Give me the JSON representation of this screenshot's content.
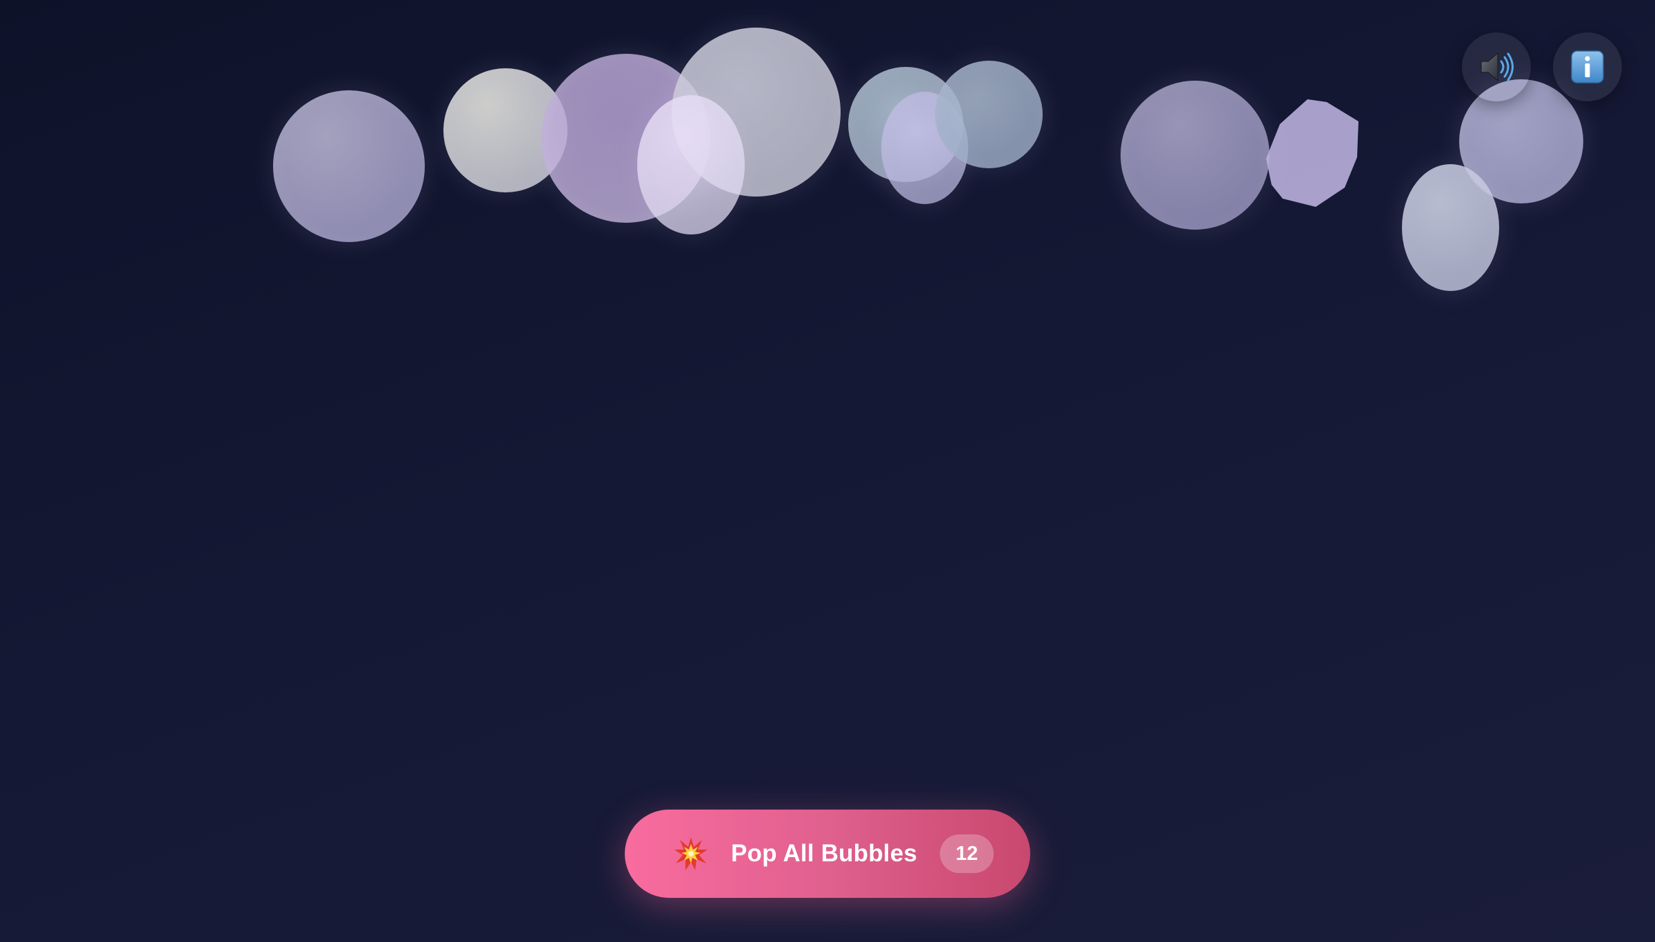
{
  "game": {
    "bubble_count_remaining": 12
  },
  "controls": {
    "sound_icon": "speaker-volume-icon",
    "info_icon": "info-icon"
  },
  "pop_all_button": {
    "icon": "collision-burst-icon",
    "label": "Pop All Bubbles",
    "count": "12"
  },
  "colors": {
    "background_top": "#0e1229",
    "background_bottom": "#1a1d3a",
    "button_gradient_start": "#f86c9e",
    "button_gradient_end": "#c8486f",
    "count_badge_bg": "rgba(255,255,255,0.25)",
    "bubble_lavender": "#a9a4d0",
    "bubble_pale": "#d9d9e6",
    "bubble_teal": "#a6b8cc",
    "bubble_purple": "#bba8de"
  },
  "bubbles": [
    {
      "id": 1,
      "color": "lavender",
      "state": "floating"
    },
    {
      "id": 2,
      "color": "pale",
      "state": "floating"
    },
    {
      "id": 3,
      "color": "purple",
      "state": "floating"
    },
    {
      "id": 4,
      "color": "pale",
      "state": "floating"
    },
    {
      "id": 5,
      "color": "pale",
      "state": "floating"
    },
    {
      "id": 6,
      "color": "teal",
      "state": "floating"
    },
    {
      "id": 7,
      "color": "lavender",
      "state": "floating"
    },
    {
      "id": 8,
      "color": "teal",
      "state": "floating"
    },
    {
      "id": 9,
      "color": "lavender",
      "state": "floating"
    },
    {
      "id": 10,
      "color": "lavender",
      "state": "popping"
    },
    {
      "id": 11,
      "color": "lavender",
      "state": "floating"
    },
    {
      "id": 12,
      "color": "pale",
      "state": "floating"
    }
  ]
}
